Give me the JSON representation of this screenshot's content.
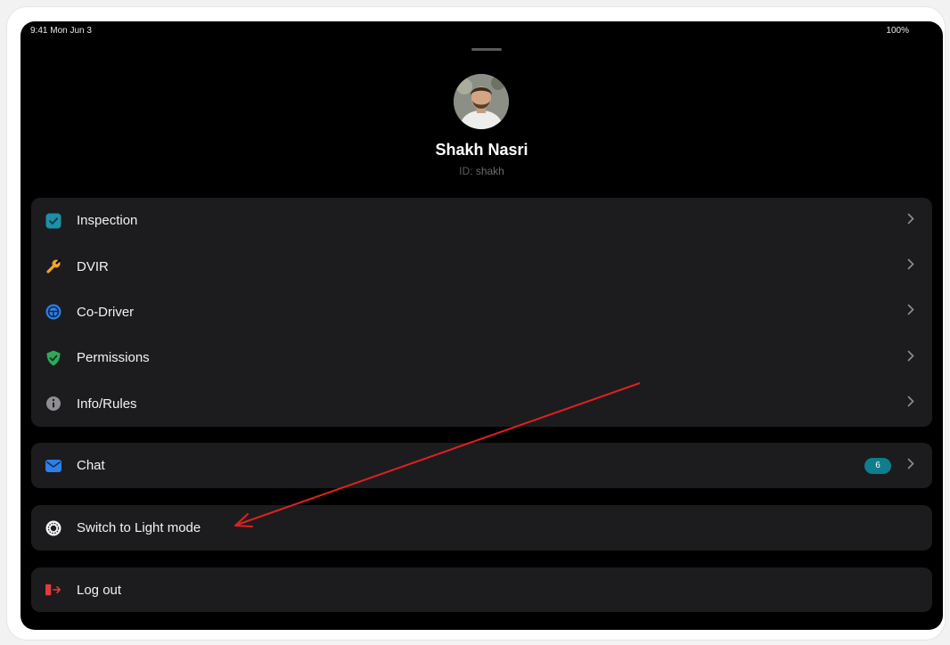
{
  "status_bar": {
    "time": "9:41  Mon Jun 3",
    "battery": "100%"
  },
  "profile": {
    "name": "Shakh Nasri",
    "id_label": "ID:",
    "id_value": "shakh"
  },
  "menu_main": [
    {
      "label": "Inspection",
      "icon": "checkbox-icon",
      "color": "#1e8fa8"
    },
    {
      "label": "DVIR",
      "icon": "wrench-icon",
      "color": "#f0a623"
    },
    {
      "label": "Co-Driver",
      "icon": "steering-wheel-icon",
      "color": "#2f7fe6"
    },
    {
      "label": "Permissions",
      "icon": "shield-check-icon",
      "color": "#2fa85a"
    },
    {
      "label": "Info/Rules",
      "icon": "info-icon",
      "color": "#8e8e93"
    }
  ],
  "chat": {
    "label": "Chat",
    "icon": "envelope-icon",
    "color": "#2f7fe6",
    "badge": "6",
    "badge_color": "#0f7d8c"
  },
  "theme_toggle": {
    "label": "Switch to Light mode",
    "icon": "sun-icon"
  },
  "logout": {
    "label": "Log out",
    "icon": "logout-icon",
    "color": "#e23b3b"
  },
  "annotation": {
    "type": "arrow",
    "color": "#e02020",
    "points_to": "theme_toggle"
  }
}
